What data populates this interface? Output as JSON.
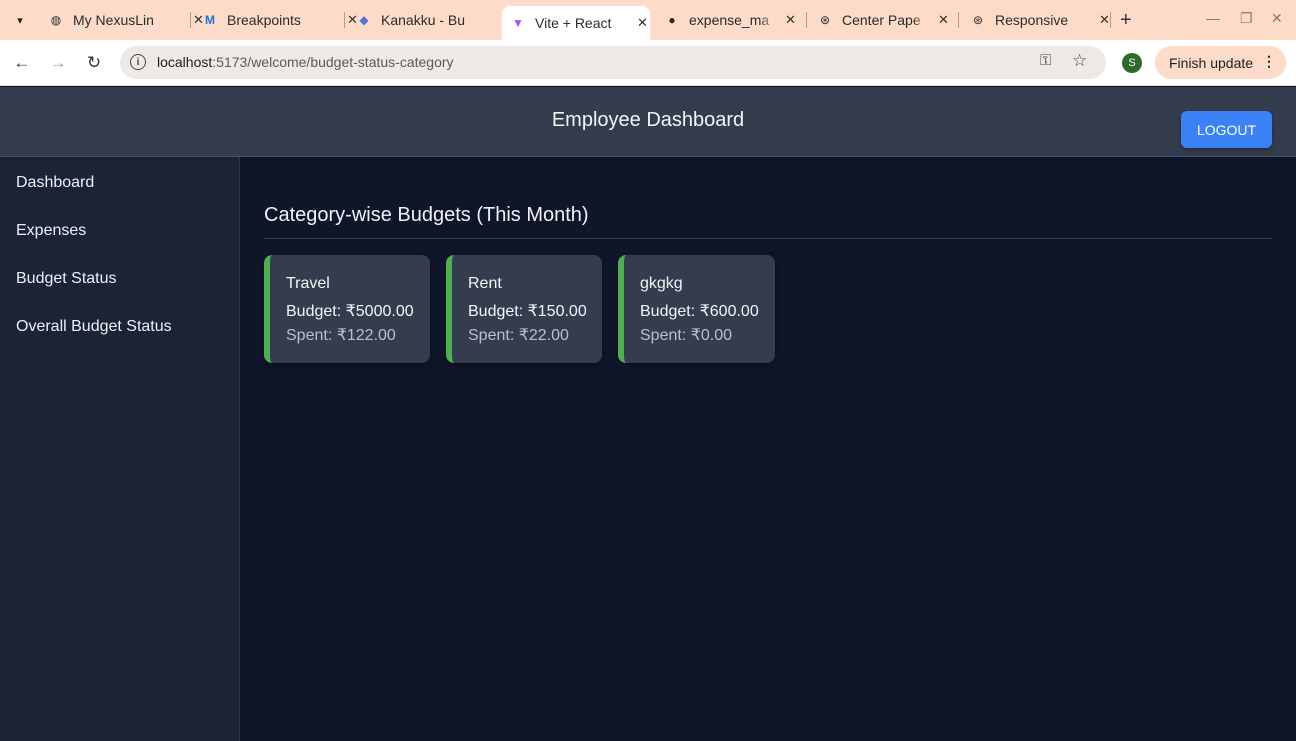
{
  "browser": {
    "tabs": [
      {
        "title": "My NexusLin",
        "icon": "globe-icon"
      },
      {
        "title": "Breakpoints",
        "icon": "mui-icon"
      },
      {
        "title": "Kanakku - Bu",
        "icon": "kanakku-icon"
      },
      {
        "title": "Vite + React",
        "icon": "vite-icon"
      },
      {
        "title": "expense_ma",
        "icon": "github-icon"
      },
      {
        "title": "Center Pape",
        "icon": "openai-icon"
      },
      {
        "title": "Responsive",
        "icon": "openai-icon"
      }
    ],
    "url_host": "localhost",
    "url_path": ":5173/welcome/budget-status-category",
    "profile_initial": "S",
    "finish_update": "Finish update"
  },
  "header": {
    "title": "Employee Dashboard",
    "logout_label": "LOGOUT"
  },
  "sidebar": {
    "items": [
      {
        "label": "Dashboard"
      },
      {
        "label": "Expenses"
      },
      {
        "label": "Budget Status"
      },
      {
        "label": "Overall Budget Status"
      }
    ]
  },
  "main": {
    "title": "Category-wise Budgets (This Month)",
    "cards": [
      {
        "category": "Travel",
        "budget": "Budget: ₹5000.00",
        "spent": "Spent: ₹122.00"
      },
      {
        "category": "Rent",
        "budget": "Budget: ₹150.00",
        "spent": "Spent: ₹22.00"
      },
      {
        "category": "gkgkg",
        "budget": "Budget: ₹600.00",
        "spent": "Spent: ₹0.00"
      }
    ]
  },
  "colors": {
    "accent": "#3b82f6",
    "card_border": "#4caf50",
    "background": "#0f1629"
  }
}
